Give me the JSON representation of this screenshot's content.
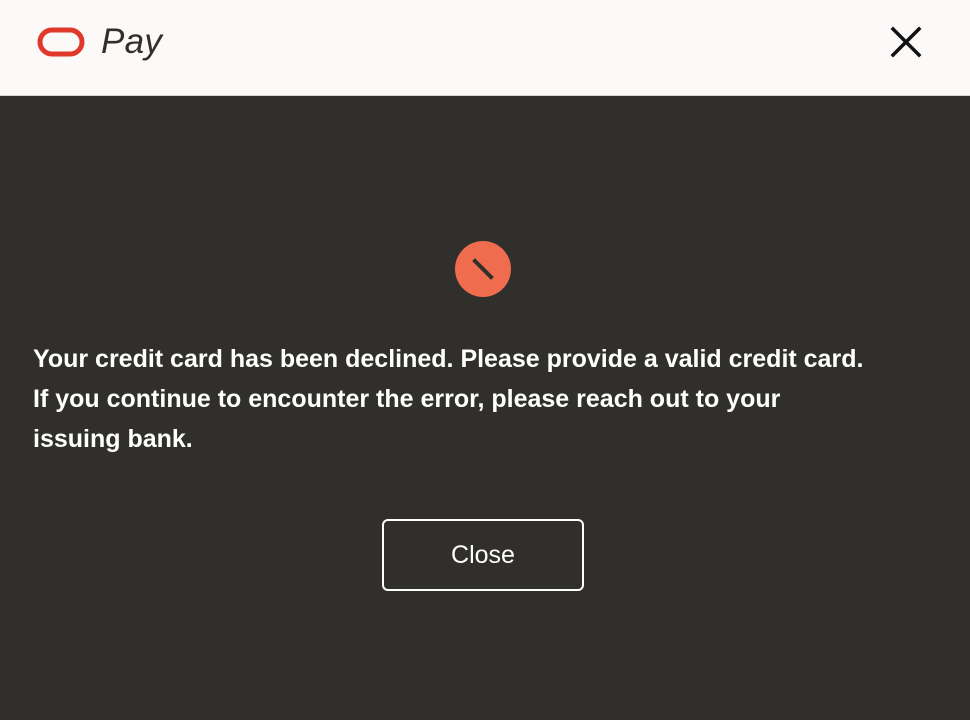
{
  "header": {
    "logo_icon": "oracle-ring-logo-icon",
    "brand_text": "Pay",
    "close_icon": "close-icon"
  },
  "colors": {
    "header_background": "#fbfaf9",
    "modal_background": "#312f2c",
    "brand_red": "#e0382a",
    "error_icon": "#ef6c4f",
    "text": "#ffffff"
  },
  "dialog": {
    "icon": "declined-icon",
    "message_lines": [
      "Your credit card has been declined. Please provide a valid credit card.",
      "If you continue to encounter the error, please reach out to your",
      "issuing bank."
    ],
    "close_label": "Close"
  }
}
